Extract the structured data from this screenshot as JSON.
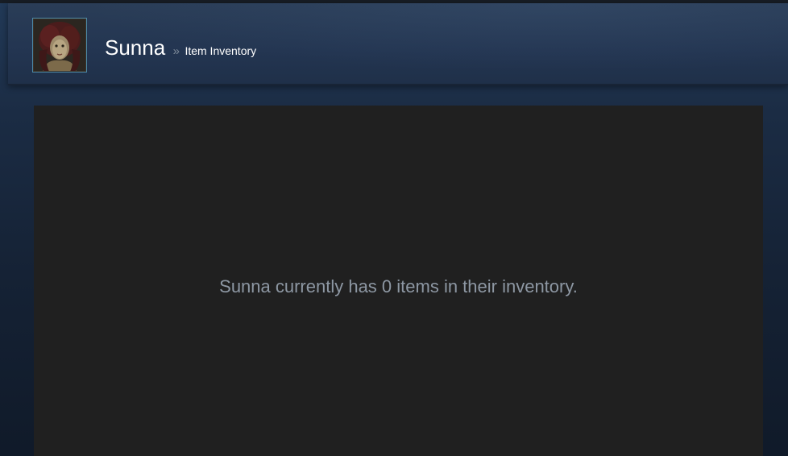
{
  "profile": {
    "persona_name": "Sunna",
    "separator": "»",
    "page_title": "Item Inventory",
    "avatar_icon": "user-avatar-icon"
  },
  "inventory": {
    "empty_message": "Sunna currently has 0 items in their inventory."
  },
  "colors": {
    "header_bg": "#233551",
    "panel_bg": "#202020",
    "empty_text": "#8d97a3",
    "avatar_border": "#4d8aa8"
  }
}
